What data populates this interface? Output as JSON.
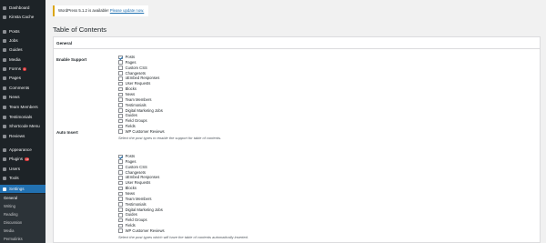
{
  "sidebar": {
    "items": [
      {
        "label": "Dashboard",
        "icon": "dashboard-icon"
      },
      {
        "label": "Kinsta Cache",
        "icon": "kinsta-cache-icon"
      },
      {
        "label": "Posts",
        "icon": "pin-icon"
      },
      {
        "label": "Jobs",
        "icon": "pin-icon"
      },
      {
        "label": "Guides",
        "icon": "pin-icon"
      },
      {
        "label": "Media",
        "icon": "media-icon"
      },
      {
        "label": "Forms",
        "icon": "forms-icon",
        "badge": "1"
      },
      {
        "label": "Pages",
        "icon": "pages-icon"
      },
      {
        "label": "Comments",
        "icon": "comments-icon"
      },
      {
        "label": "News",
        "icon": "pin-icon"
      },
      {
        "label": "Team Members",
        "icon": "pin-icon"
      },
      {
        "label": "Testimonials",
        "icon": "pin-icon"
      },
      {
        "label": "Shortcode Menu",
        "icon": "shortcode-icon"
      },
      {
        "label": "Reviews",
        "icon": "reviews-icon"
      },
      {
        "label": "Appearance",
        "icon": "appearance-icon"
      },
      {
        "label": "Plugins",
        "icon": "plugins-icon",
        "badge": "13"
      },
      {
        "label": "Users",
        "icon": "users-icon"
      },
      {
        "label": "Tools",
        "icon": "tools-icon"
      },
      {
        "label": "Settings",
        "icon": "settings-icon",
        "current": true
      }
    ],
    "submenu": [
      "General",
      "Writing",
      "Reading",
      "Discussion",
      "Media",
      "Permalinks"
    ]
  },
  "notice": {
    "text": "WordPress 5.1.2 is available! ",
    "link": "Please update now."
  },
  "page_title": "Table of Contents",
  "panel": {
    "header": "General",
    "enable_support": {
      "label": "Enable Support",
      "options": [
        {
          "label": "Posts",
          "checked": true
        },
        {
          "label": "Pages",
          "checked": false
        },
        {
          "label": "Custom CSS",
          "checked": false
        },
        {
          "label": "Changesets",
          "checked": false
        },
        {
          "label": "oEmbed Responses",
          "checked": false
        },
        {
          "label": "User Requests",
          "checked": false
        },
        {
          "label": "Blocks",
          "checked": false
        },
        {
          "label": "News",
          "checked": false
        },
        {
          "label": "Team Members",
          "checked": false
        },
        {
          "label": "Testimonials",
          "checked": false
        },
        {
          "label": "Digital Marketing Jobs",
          "checked": false
        },
        {
          "label": "Guides",
          "checked": false
        },
        {
          "label": "Field Groups",
          "checked": false
        },
        {
          "label": "Fields",
          "checked": false
        },
        {
          "label": "WP Customer Reviews",
          "checked": false
        }
      ],
      "description": "Select the post types to enable the support for table of contents."
    },
    "auto_insert": {
      "label": "Auto Insert",
      "options": [
        {
          "label": "Posts",
          "checked": true
        },
        {
          "label": "Pages",
          "checked": false
        },
        {
          "label": "Custom CSS",
          "checked": false
        },
        {
          "label": "Changesets",
          "checked": false
        },
        {
          "label": "oEmbed Responses",
          "checked": false
        },
        {
          "label": "User Requests",
          "checked": false
        },
        {
          "label": "Blocks",
          "checked": false
        },
        {
          "label": "News",
          "checked": false
        },
        {
          "label": "Team Members",
          "checked": false
        },
        {
          "label": "Testimonials",
          "checked": false
        },
        {
          "label": "Digital Marketing Jobs",
          "checked": false
        },
        {
          "label": "Guides",
          "checked": false
        },
        {
          "label": "Field Groups",
          "checked": false
        },
        {
          "label": "Fields",
          "checked": false
        },
        {
          "label": "WP Customer Reviews",
          "checked": false
        }
      ],
      "description": "Select the post types which will have the table of contents automatically inserted."
    }
  },
  "colors": {
    "sidebar_bg": "#1d2327",
    "accent": "#2271b1",
    "badge": "#d63638",
    "notice_border": "#dba617"
  }
}
